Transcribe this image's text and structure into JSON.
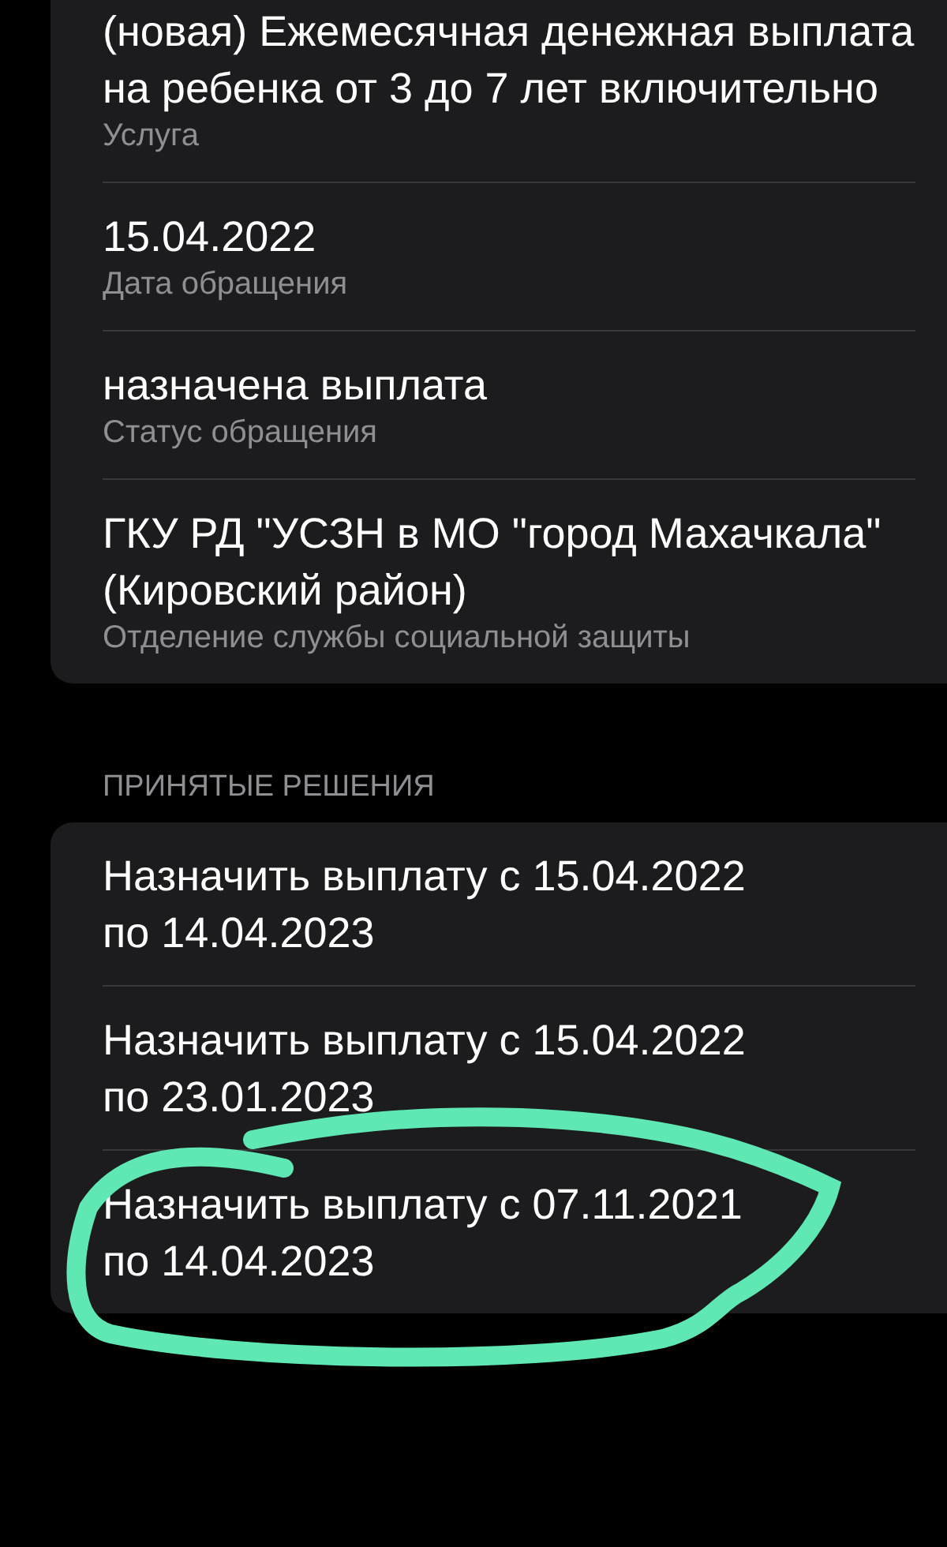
{
  "details": [
    {
      "value": "(новая) Ежемесячная денежная выплата на ребенка от 3 до 7 лет включительно",
      "label": "Услуга"
    },
    {
      "value": "15.04.2022",
      "label": "Дата обращения"
    },
    {
      "value": "назначена выплата",
      "label": "Статус обращения"
    },
    {
      "value": "ГКУ РД \"УСЗН в МО \"город Махачкала\" (Кировский район)",
      "label": "Отделение службы социальной защиты"
    }
  ],
  "decisions_header": "ПРИНЯТЫЕ РЕШЕНИЯ",
  "decisions": [
    {
      "text": "Назначить выплату с 15.04.2022 по 14.04.2023"
    },
    {
      "text": "Назначить выплату с 15.04.2022 по 23.01.2023"
    },
    {
      "text": "Назначить выплату с 07.11.2021 по 14.04.2023"
    }
  ],
  "annotations": [
    {
      "kind": "scribble",
      "color": "#5fe8b4"
    }
  ]
}
